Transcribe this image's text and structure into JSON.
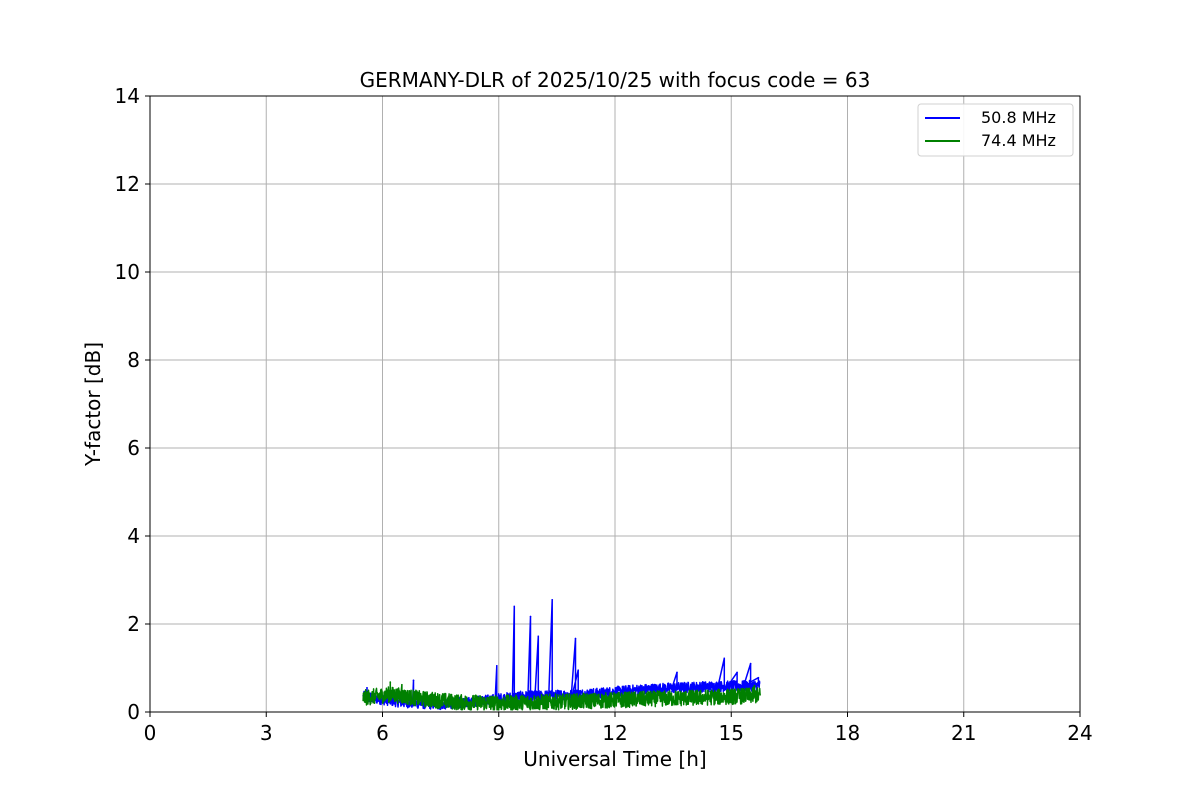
{
  "chart_data": {
    "type": "line",
    "title": "GERMANY-DLR of 2025/10/25 with focus code = 63",
    "xlabel": "Universal Time [h]",
    "ylabel": "Y-factor [dB]",
    "xlim": [
      0,
      24
    ],
    "ylim": [
      0,
      14
    ],
    "xticks": [
      0,
      3,
      6,
      9,
      12,
      15,
      18,
      21,
      24
    ],
    "yticks": [
      0,
      2,
      4,
      6,
      8,
      10,
      12,
      14
    ],
    "grid": true,
    "legend_position": "top-right",
    "series": [
      {
        "name": "50.8 MHz",
        "color": "#0000ff",
        "x_range": [
          5.5,
          15.75
        ],
        "baseline": [
          [
            5.5,
            0.35
          ],
          [
            6.5,
            0.22
          ],
          [
            7.5,
            0.17
          ],
          [
            8.5,
            0.25
          ],
          [
            9.5,
            0.35
          ],
          [
            10.5,
            0.38
          ],
          [
            11.5,
            0.42
          ],
          [
            12.5,
            0.5
          ],
          [
            13.5,
            0.55
          ],
          [
            14.5,
            0.58
          ],
          [
            15.75,
            0.6
          ]
        ],
        "noise_amplitude": 0.12,
        "peaks": [
          [
            5.6,
            0.55
          ],
          [
            6.8,
            0.72
          ],
          [
            8.95,
            1.05
          ],
          [
            9.4,
            2.4
          ],
          [
            9.82,
            2.17
          ],
          [
            10.02,
            1.72
          ],
          [
            10.38,
            2.55
          ],
          [
            10.98,
            1.67
          ],
          [
            11.05,
            0.95
          ],
          [
            13.6,
            0.9
          ],
          [
            14.82,
            1.22
          ],
          [
            15.15,
            0.9
          ],
          [
            15.5,
            1.1
          ],
          [
            15.7,
            0.78
          ]
        ]
      },
      {
        "name": "74.4 MHz",
        "color": "#008000",
        "x_range": [
          5.5,
          15.75
        ],
        "baseline": [
          [
            5.5,
            0.32
          ],
          [
            6.2,
            0.4
          ],
          [
            7.0,
            0.3
          ],
          [
            8.0,
            0.22
          ],
          [
            9.0,
            0.2
          ],
          [
            10.0,
            0.22
          ],
          [
            11.0,
            0.24
          ],
          [
            12.0,
            0.27
          ],
          [
            13.0,
            0.3
          ],
          [
            14.0,
            0.32
          ],
          [
            15.0,
            0.35
          ],
          [
            15.75,
            0.38
          ]
        ],
        "noise_amplitude": 0.18,
        "peaks": [
          [
            6.2,
            0.68
          ],
          [
            6.5,
            0.62
          ],
          [
            15.6,
            0.6
          ]
        ]
      }
    ]
  }
}
